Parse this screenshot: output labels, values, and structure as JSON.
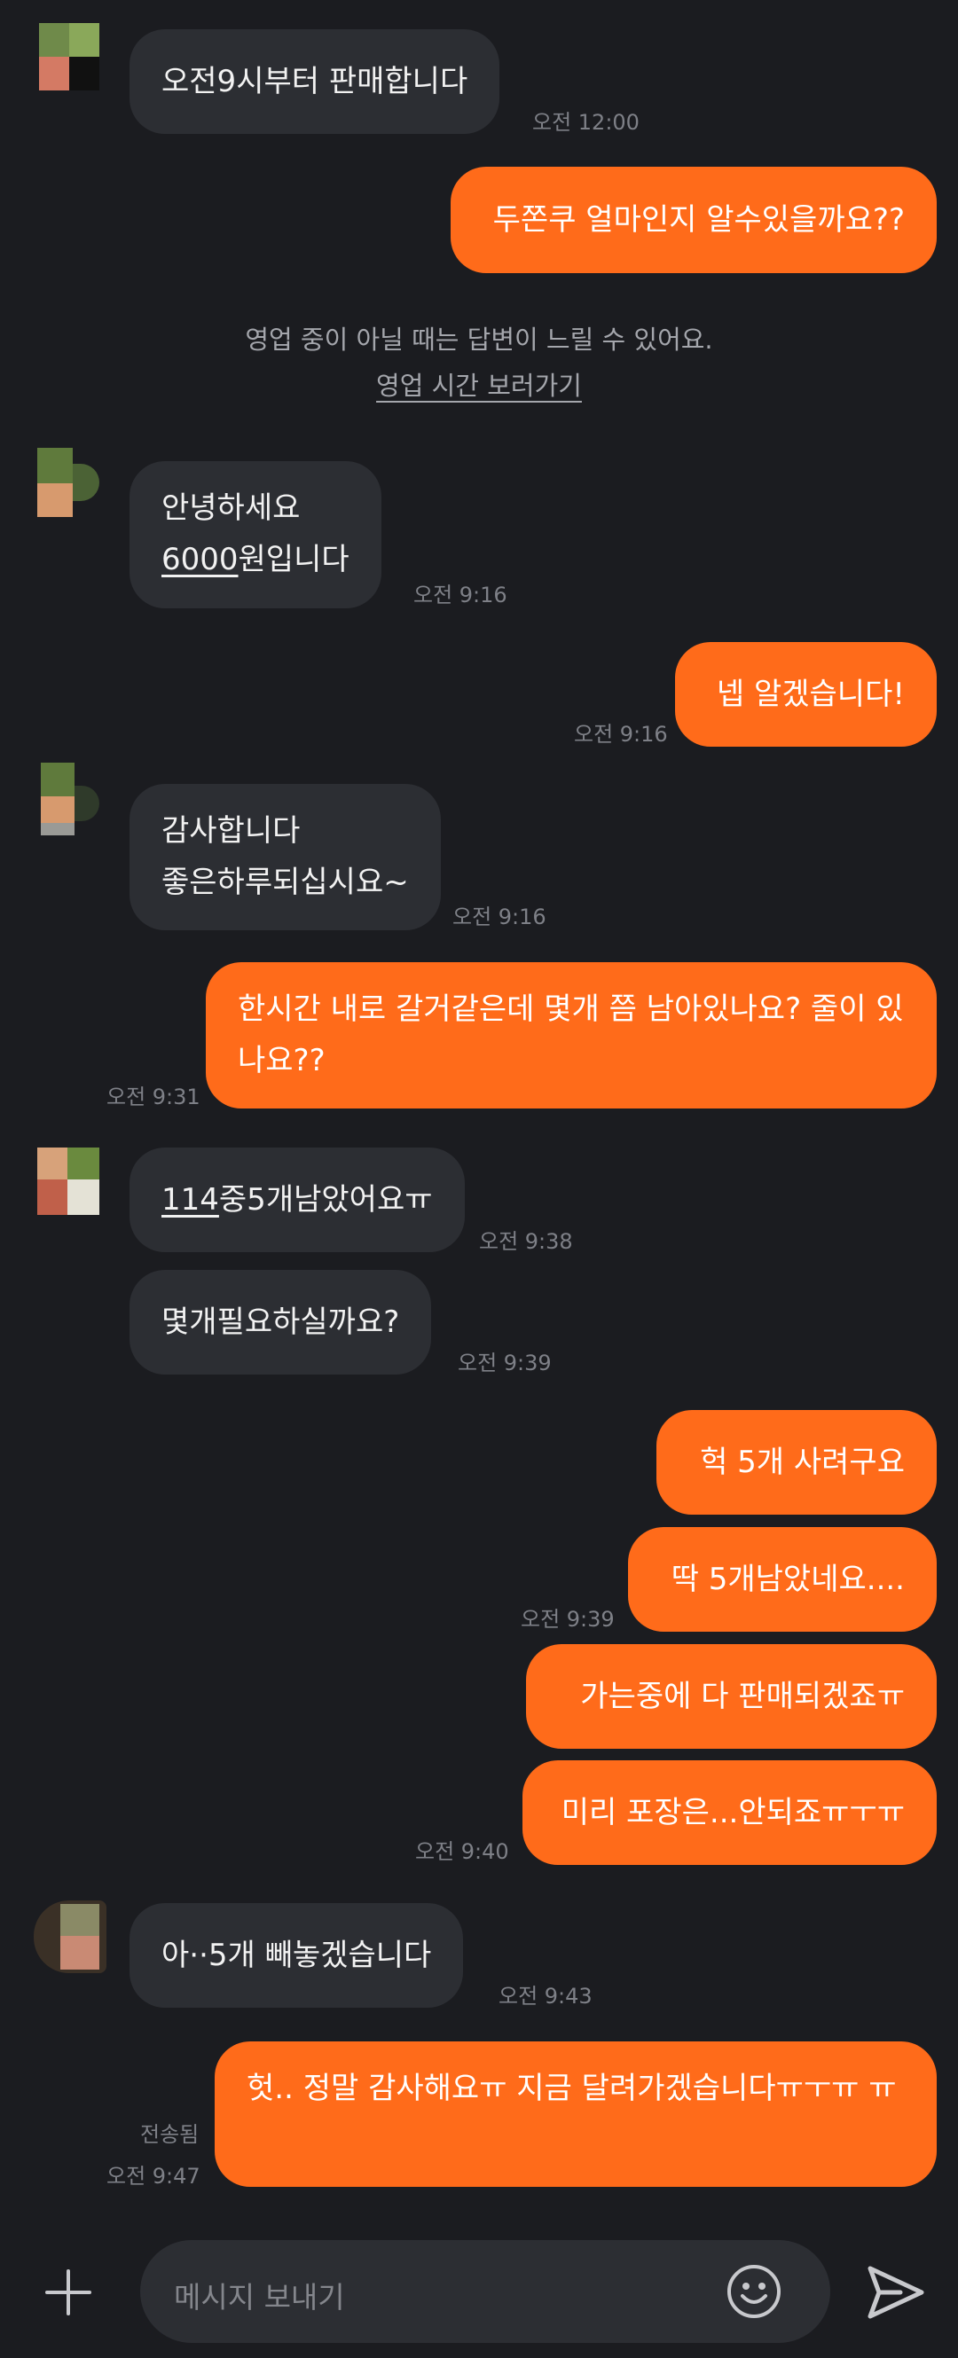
{
  "messages": [
    {
      "side": "in",
      "lines": [
        "오전9시부터 판매합니다"
      ],
      "time": "오전 12:00"
    },
    {
      "side": "out",
      "lines": [
        "두쫀쿠 얼마인지 알수있을까요??"
      ],
      "time": ""
    },
    {
      "side": "in",
      "lines": [
        "안녕하세요",
        "6000원입니다"
      ],
      "time": "오전 9:16"
    },
    {
      "side": "out",
      "lines": [
        "넵 알겠습니다!"
      ],
      "time": "오전 9:16"
    },
    {
      "side": "in",
      "lines": [
        "감사합니다",
        "좋은하루되십시요~"
      ],
      "time": "오전 9:16"
    },
    {
      "side": "out",
      "lines": [
        "한시간 내로 갈거같은데 몇개 쯤 남아있나요? 줄이 있나요??"
      ],
      "time": "오전 9:31"
    },
    {
      "side": "in",
      "lines": [
        "114중5개남았어요ㅠ"
      ],
      "time": "오전 9:38"
    },
    {
      "side": "in",
      "lines": [
        "몇개필요하실까요?"
      ],
      "time": "오전 9:39"
    },
    {
      "side": "out",
      "lines": [
        "헉 5개 사려구요"
      ],
      "time": ""
    },
    {
      "side": "out",
      "lines": [
        "딱 5개남았네요...."
      ],
      "time": "오전 9:39"
    },
    {
      "side": "out",
      "lines": [
        "가는중에 다 판매되겠죠ㅠ"
      ],
      "time": ""
    },
    {
      "side": "out",
      "lines": [
        "미리 포장은...안되죠ㅠㅜㅠ"
      ],
      "time": "오전 9:40"
    },
    {
      "side": "in",
      "lines": [
        "아··5개 빼놓겠습니다"
      ],
      "time": "오전 9:43"
    },
    {
      "side": "out",
      "lines": [
        "헛.. 정말 감사해요ㅠ 지금 달려가겠습니다ㅠㅜㅠ ㅠ"
      ],
      "time": "오전 9:47",
      "status": "전송됨"
    }
  ],
  "underlined": [
    "6000",
    "114"
  ],
  "notice": {
    "text": "영업 중이 아닐 때는 답변이 느릴 수 있어요.",
    "link": "영업 시간 보러가기"
  },
  "input": {
    "placeholder": "메시지 보내기"
  },
  "icons": {
    "add": "plus-icon",
    "emoji": "smile-icon",
    "send": "send-icon"
  },
  "colors": {
    "background": "#1b1c20",
    "incoming": "#2c2e33",
    "outgoing": "#ff6b1a",
    "time": "#7e8087"
  }
}
